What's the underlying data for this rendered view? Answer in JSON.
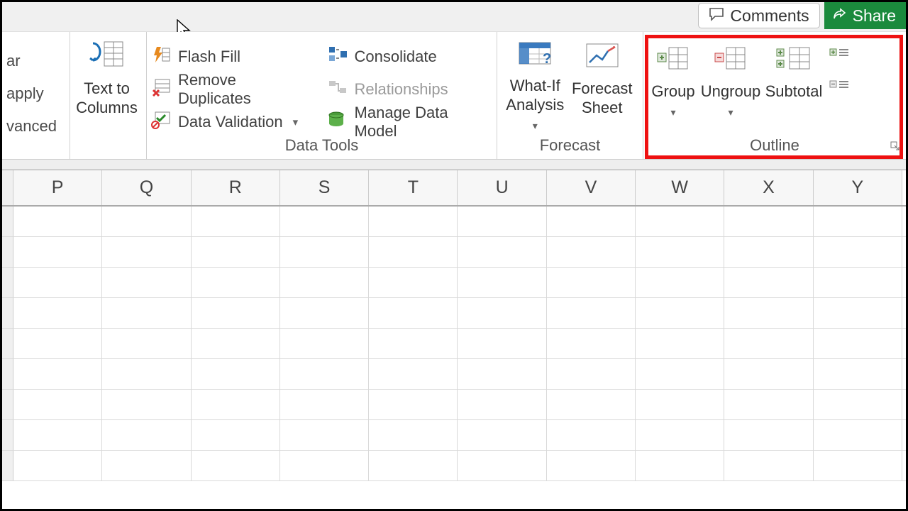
{
  "top": {
    "comments": "Comments",
    "share": "Share"
  },
  "sort_filter": {
    "l1": "ar",
    "l2": "apply",
    "l3": "vanced"
  },
  "text_to_columns": {
    "label": "Text to\nColumns"
  },
  "data_tools": {
    "label": "Data Tools",
    "flash_fill": "Flash Fill",
    "remove_dup": "Remove Duplicates",
    "data_val": "Data Validation",
    "consolidate": "Consolidate",
    "relationships": "Relationships",
    "manage_dm": "Manage Data Model"
  },
  "forecast": {
    "label": "Forecast",
    "whatif": "What-If\nAnalysis",
    "fs": "Forecast\nSheet"
  },
  "outline": {
    "label": "Outline",
    "group": "Group",
    "ungroup": "Ungroup",
    "subtotal": "Subtotal"
  },
  "columns": [
    "P",
    "Q",
    "R",
    "S",
    "T",
    "U",
    "V",
    "W",
    "X",
    "Y"
  ],
  "rows_visible_count": 9
}
